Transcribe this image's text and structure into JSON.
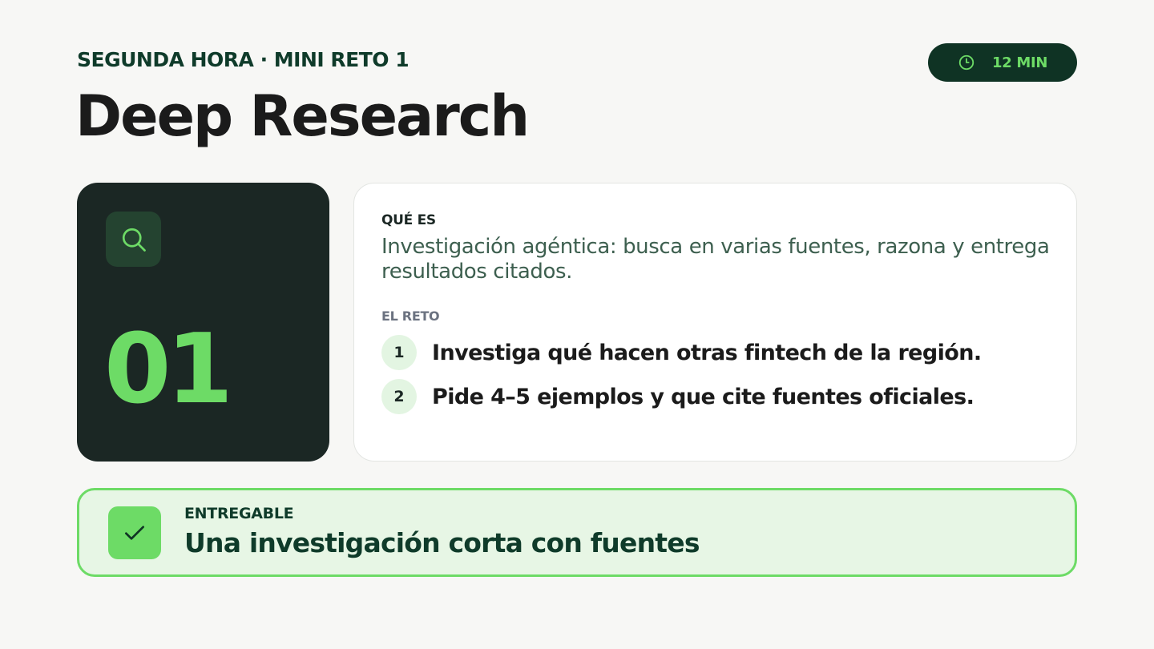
{
  "header": {
    "eyebrow": "SEGUNDA HORA · MINI RETO 1",
    "title": "Deep Research",
    "time_badge": {
      "icon": "clock-icon",
      "label": "12 MIN"
    }
  },
  "number_card": {
    "icon": "search-icon",
    "number": "01"
  },
  "info_card": {
    "what_label": "QUÉ ES",
    "description": "Investigación agéntica: busca en varias fuentes, razona y entrega resultados citados.",
    "challenge_label": "EL RETO",
    "steps": [
      {
        "number": "1",
        "text": "Investiga qué hacen otras fintech de la región."
      },
      {
        "number": "2",
        "text": "Pide 4–5 ejemplos y que cite fuentes oficiales."
      }
    ]
  },
  "deliverable": {
    "icon": "check-icon",
    "label": "ENTREGABLE",
    "text": "Una investigación corta con fuentes"
  },
  "colors": {
    "accent_green": "#6ddb66",
    "dark_green": "#0f3324",
    "card_dark": "#1b2724",
    "background": "#f7f7f5"
  }
}
